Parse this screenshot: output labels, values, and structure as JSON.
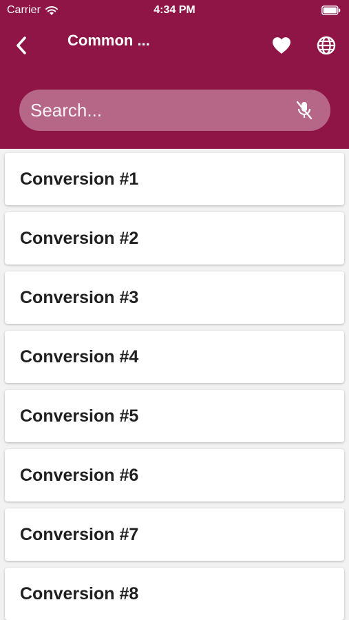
{
  "status_bar": {
    "carrier": "Carrier",
    "time": "4:34 PM",
    "icons": [
      "wifi-icon",
      "battery-icon"
    ]
  },
  "nav": {
    "title": "Common ...",
    "icons": [
      "back-icon",
      "heart-icon",
      "globe-icon"
    ]
  },
  "search": {
    "placeholder": "Search...",
    "value": "",
    "icon": "mic-off-icon"
  },
  "colors": {
    "header": "#8f1547",
    "card": "#ffffff",
    "text": "#202020"
  },
  "items": [
    {
      "label": "Conversion #1"
    },
    {
      "label": "Conversion #2"
    },
    {
      "label": "Conversion #3"
    },
    {
      "label": "Conversion #4"
    },
    {
      "label": "Conversion #5"
    },
    {
      "label": "Conversion #6"
    },
    {
      "label": "Conversion #7"
    },
    {
      "label": "Conversion #8"
    }
  ]
}
